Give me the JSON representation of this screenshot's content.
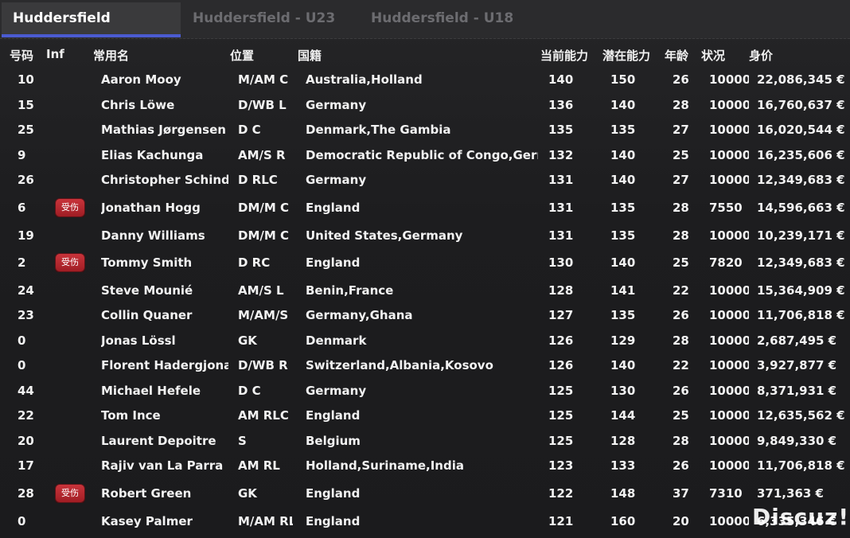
{
  "tabs": [
    {
      "label": "Huddersfield",
      "active": true
    },
    {
      "label": "Huddersfield - U23",
      "active": false
    },
    {
      "label": "Huddersfield - U18",
      "active": false
    }
  ],
  "columns": {
    "number": "号码",
    "inf": "Inf",
    "name": "常用名",
    "position": "位置",
    "nationality": "国籍",
    "current_ability": "当前能力",
    "potential_ability": "潜在能力",
    "age": "年龄",
    "condition": "状况",
    "value": "身价"
  },
  "injury_label": "受伤",
  "players": [
    {
      "number": "10",
      "inf": "",
      "name": "Aaron Mooy",
      "position": "M/AM C",
      "nationality": "Australia,Holland",
      "ca": "140",
      "pa": "150",
      "age": "26",
      "condition": "10000",
      "value": "22,086,345 €"
    },
    {
      "number": "15",
      "inf": "",
      "name": "Chris Löwe",
      "position": "D/WB L",
      "nationality": "Germany",
      "ca": "136",
      "pa": "140",
      "age": "28",
      "condition": "10000",
      "value": "16,760,637 €"
    },
    {
      "number": "25",
      "inf": "",
      "name": "Mathias Jørgensen",
      "position": "D C",
      "nationality": "Denmark,The Gambia",
      "ca": "135",
      "pa": "135",
      "age": "27",
      "condition": "10000",
      "value": "16,020,544 €"
    },
    {
      "number": "9",
      "inf": "",
      "name": "Elias Kachunga",
      "position": "AM/S R",
      "nationality": "Democratic Republic of Congo,Germany",
      "ca": "132",
      "pa": "140",
      "age": "25",
      "condition": "10000",
      "value": "16,235,606 €"
    },
    {
      "number": "26",
      "inf": "",
      "name": "Christopher Schindler",
      "position": "D RLC",
      "nationality": "Germany",
      "ca": "131",
      "pa": "140",
      "age": "27",
      "condition": "10000",
      "value": "12,349,683 €"
    },
    {
      "number": "6",
      "inf": "受伤",
      "name": "Jonathan Hogg",
      "position": "DM/M C",
      "nationality": "England",
      "ca": "131",
      "pa": "135",
      "age": "28",
      "condition": "7550",
      "value": "14,596,663 €"
    },
    {
      "number": "19",
      "inf": "",
      "name": "Danny Williams",
      "position": "DM/M C",
      "nationality": "United States,Germany",
      "ca": "131",
      "pa": "135",
      "age": "28",
      "condition": "10000",
      "value": "10,239,171 €"
    },
    {
      "number": "2",
      "inf": "受伤",
      "name": "Tommy Smith",
      "position": "D RC",
      "nationality": "England",
      "ca": "130",
      "pa": "140",
      "age": "25",
      "condition": "7820",
      "value": "12,349,683 €"
    },
    {
      "number": "24",
      "inf": "",
      "name": "Steve Mounié",
      "position": "AM/S L",
      "nationality": "Benin,France",
      "ca": "128",
      "pa": "141",
      "age": "22",
      "condition": "10000",
      "value": "15,364,909 €"
    },
    {
      "number": "23",
      "inf": "",
      "name": "Collin Quaner",
      "position": "M/AM/S R",
      "nationality": "Germany,Ghana",
      "ca": "127",
      "pa": "135",
      "age": "26",
      "condition": "10000",
      "value": "11,706,818 €"
    },
    {
      "number": "0",
      "inf": "",
      "name": "Jonas Lössl",
      "position": "GK",
      "nationality": "Denmark",
      "ca": "126",
      "pa": "129",
      "age": "28",
      "condition": "10000",
      "value": "2,687,495 €"
    },
    {
      "number": "0",
      "inf": "",
      "name": "Florent Hadergjonaj",
      "position": "D/WB R",
      "nationality": "Switzerland,Albania,Kosovo",
      "ca": "126",
      "pa": "140",
      "age": "22",
      "condition": "10000",
      "value": "3,927,877 €"
    },
    {
      "number": "44",
      "inf": "",
      "name": "Michael Hefele",
      "position": "D C",
      "nationality": "Germany",
      "ca": "125",
      "pa": "130",
      "age": "26",
      "condition": "10000",
      "value": "8,371,931 €"
    },
    {
      "number": "22",
      "inf": "",
      "name": "Tom Ince",
      "position": "AM RLC",
      "nationality": "England",
      "ca": "125",
      "pa": "144",
      "age": "25",
      "condition": "10000",
      "value": "12,635,562 €"
    },
    {
      "number": "20",
      "inf": "",
      "name": "Laurent Depoitre",
      "position": "S",
      "nationality": "Belgium",
      "ca": "125",
      "pa": "128",
      "age": "28",
      "condition": "10000",
      "value": "9,849,330 €"
    },
    {
      "number": "17",
      "inf": "",
      "name": "Rajiv van La Parra",
      "position": "AM RL",
      "nationality": "Holland,Suriname,India",
      "ca": "123",
      "pa": "133",
      "age": "26",
      "condition": "10000",
      "value": "11,706,818 €"
    },
    {
      "number": "28",
      "inf": "受伤",
      "name": "Robert Green",
      "position": "GK",
      "nationality": "England",
      "ca": "122",
      "pa": "148",
      "age": "37",
      "condition": "7310",
      "value": "371,363 €"
    },
    {
      "number": "0",
      "inf": "",
      "name": "Kasey Palmer",
      "position": "M/AM RL",
      "nationality": "England",
      "ca": "121",
      "pa": "160",
      "age": "20",
      "condition": "10000",
      "value": "6,335,346 €"
    }
  ],
  "watermark": "Discuz!",
  "colors": {
    "active_tab_underline": "#4b5bd0",
    "injury_badge": "#b8262d",
    "background": "#1f1f21"
  }
}
